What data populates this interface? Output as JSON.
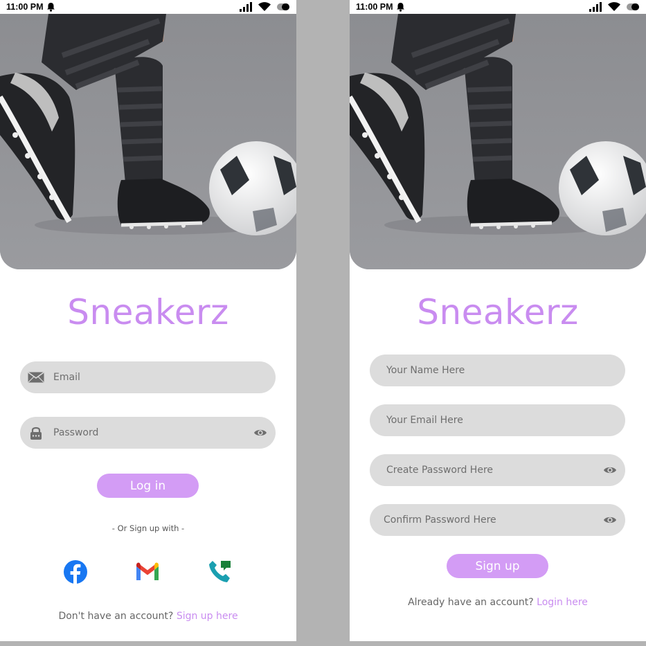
{
  "status_bar": {
    "time": "11:00 PM"
  },
  "brand": "Sneakerz",
  "colors": {
    "accent": "#c98cf0",
    "button": "#d39cf5",
    "field": "#dcdcdc",
    "gutter": "#b3b3b3"
  },
  "login": {
    "email_placeholder": "Email",
    "password_placeholder": "Password",
    "login_button": "Log in",
    "divider": "- Or  Sign up with -",
    "social": [
      "facebook-icon",
      "gmail-icon",
      "google-voice-icon"
    ],
    "footer_text": "Don't have an account?",
    "footer_link": "Sign up here"
  },
  "signup": {
    "name_placeholder": "Your Name Here",
    "email_placeholder": "Your Email Here",
    "create_password_placeholder": "Create Password Here",
    "confirm_password_placeholder": "Confirm Password Here",
    "signup_button": "Sign up",
    "footer_text": "Already have an account?",
    "footer_link": "Login here"
  }
}
